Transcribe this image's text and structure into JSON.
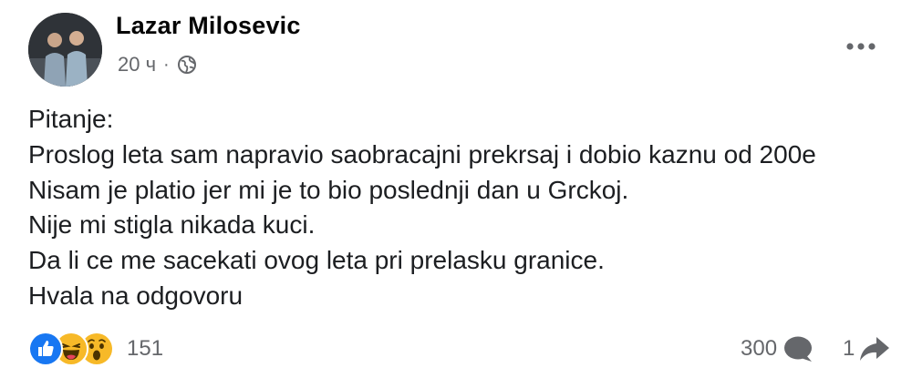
{
  "post": {
    "author": "Lazar Milosevic",
    "timestamp": "20 ч",
    "separator": "·",
    "audience_icon": "globe-icon",
    "more_icon": "more-options-icon",
    "body_lines": [
      "Pitanje:",
      "Proslog leta sam napravio saobracajni prekrsaj i dobio kaznu od 200e",
      "Nisam je platio jer mi je to bio poslednji dan u Grckoj.",
      "Nije mi stigla nikada kuci.",
      "Da li ce me sacekati ovog leta pri prelasku granice.",
      "Hvala na odgovoru"
    ]
  },
  "footer": {
    "reactions": [
      "like-reaction-icon",
      "haha-reaction-icon",
      "wow-reaction-icon"
    ],
    "reaction_count": "151",
    "comment_count": "300",
    "comment_icon": "comment-icon",
    "share_count": "1",
    "share_icon": "share-icon"
  },
  "colors": {
    "text": "#050505",
    "secondary_text": "#65676b",
    "like_blue": "#1877f2",
    "emoji_yellow": "#f7b928"
  }
}
